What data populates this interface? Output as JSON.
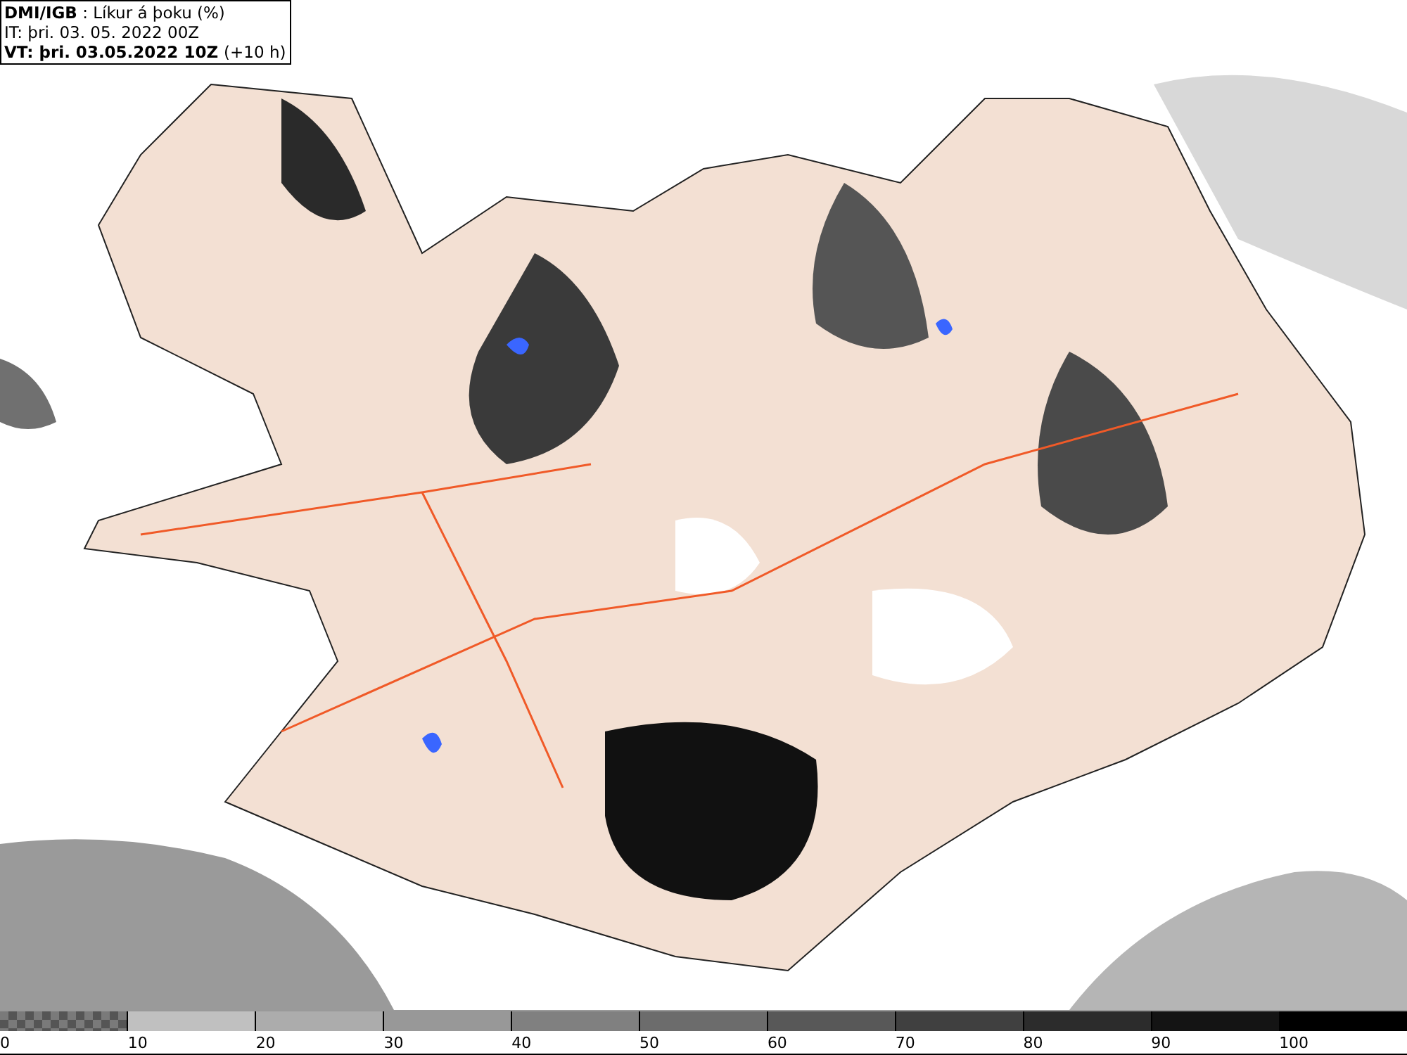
{
  "header": {
    "source": "DMI/IGB",
    "separator": " : ",
    "product": "Líkur á þoku (%)",
    "issue_time": "IT: þri. 03. 05. 2022 00Z",
    "valid_time": "VT: þri. 03.05.2022 10Z",
    "lead": "(+10 h)"
  },
  "legend": {
    "swatches": [
      {
        "kind": "checker",
        "color": "#7a7a7a"
      },
      {
        "kind": "solid",
        "color": "#c0c0c0"
      },
      {
        "kind": "solid",
        "color": "#acacac"
      },
      {
        "kind": "solid",
        "color": "#989898"
      },
      {
        "kind": "solid",
        "color": "#808080"
      },
      {
        "kind": "solid",
        "color": "#6c6c6c"
      },
      {
        "kind": "solid",
        "color": "#585858"
      },
      {
        "kind": "solid",
        "color": "#404040"
      },
      {
        "kind": "solid",
        "color": "#2c2c2c"
      },
      {
        "kind": "solid",
        "color": "#141414"
      },
      {
        "kind": "solid",
        "color": "#000000"
      }
    ],
    "ticks": [
      "0",
      "10",
      "20",
      "30",
      "40",
      "50",
      "60",
      "70",
      "80",
      "90",
      "100"
    ]
  }
}
